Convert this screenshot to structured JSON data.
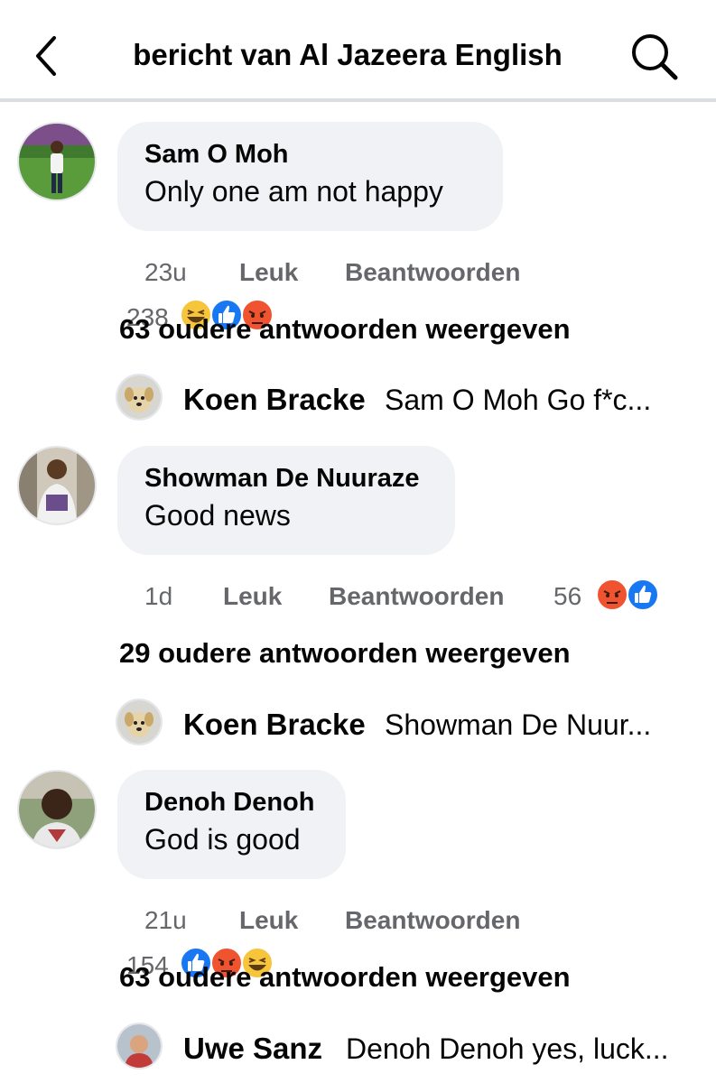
{
  "header": {
    "title": "bericht van Al Jazeera English"
  },
  "comments": [
    {
      "author": "Sam O Moh",
      "text": "Only one am not happy",
      "time": "23u",
      "like_label": "Leuk",
      "reply_label": "Beantwoorden",
      "reaction_count": "238",
      "reactions": [
        "haha-icon",
        "like-icon",
        "angry-icon"
      ],
      "more_replies": "63 oudere antwoorden weergeven",
      "last_reply": {
        "name": "Koen Bracke",
        "text": "Sam O Moh Go f*c..."
      }
    },
    {
      "author": "Showman De Nuuraze",
      "text": "Good news",
      "time": "1d",
      "like_label": "Leuk",
      "reply_label": "Beantwoorden",
      "reaction_count": "56",
      "reactions": [
        "angry-icon",
        "like-icon"
      ],
      "more_replies": "29 oudere antwoorden weergeven",
      "last_reply": {
        "name": "Koen Bracke",
        "text": "Showman De Nuur..."
      }
    },
    {
      "author": "Denoh Denoh",
      "text": "God is good",
      "time": "21u",
      "like_label": "Leuk",
      "reply_label": "Beantwoorden",
      "reaction_count": "154",
      "reactions": [
        "like-icon",
        "angry-icon",
        "haha-icon"
      ],
      "more_replies": "63 oudere antwoorden weergeven",
      "last_reply": {
        "name": "Uwe Sanz",
        "text": "Denoh Denoh yes, luck..."
      }
    }
  ],
  "colors": {
    "like_blue": "#1877f2",
    "angry_orange": "#f0532f",
    "haha_yellow": "#f7c53c",
    "bubble_bg": "#f0f2f5",
    "meta_gray": "#65676b"
  }
}
